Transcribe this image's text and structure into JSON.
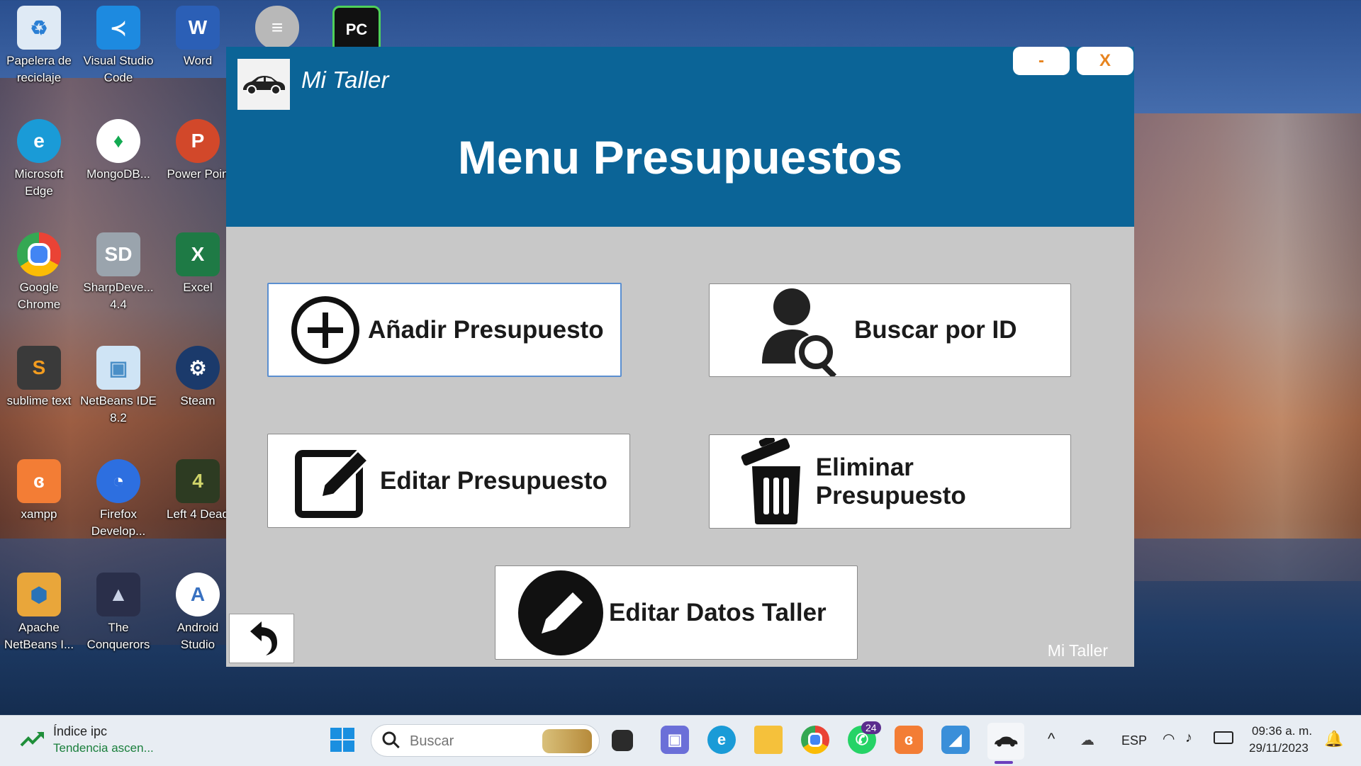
{
  "desktop": {
    "icons": [
      {
        "label": "Papelera de reciclaje",
        "icon": "recycle-bin-icon"
      },
      {
        "label": "Visual Studio Code",
        "icon": "vscode-icon"
      },
      {
        "label": "Word",
        "icon": "word-icon"
      },
      {
        "label": "Microsoft Edge",
        "icon": "edge-icon"
      },
      {
        "label": "MongoDB...",
        "icon": "mongodb-icon"
      },
      {
        "label": "Power Poin",
        "icon": "powerpoint-icon"
      },
      {
        "label": "Google Chrome",
        "icon": "chrome-icon"
      },
      {
        "label": "SharpDeve... 4.4",
        "icon": "sharpdevelop-icon"
      },
      {
        "label": "Excel",
        "icon": "excel-icon"
      },
      {
        "label": "sublime text",
        "icon": "sublime-icon"
      },
      {
        "label": "NetBeans IDE 8.2",
        "icon": "netbeans-icon"
      },
      {
        "label": "Steam",
        "icon": "steam-icon"
      },
      {
        "label": "xampp",
        "icon": "xampp-icon"
      },
      {
        "label": "Firefox Develop...",
        "icon": "firefox-icon"
      },
      {
        "label": "Left 4 Dead",
        "icon": "left4dead-icon"
      },
      {
        "label": "Apache NetBeans I...",
        "icon": "apache-netbeans-icon"
      },
      {
        "label": "The Conquerors",
        "icon": "conquerors-icon"
      },
      {
        "label": "Android Studio",
        "icon": "android-studio-icon"
      }
    ],
    "top_icons": [
      "database-icon",
      "pycharm-icon"
    ]
  },
  "window": {
    "title": "Mi Taller",
    "heading": "Menu Presupuestos",
    "minimize_label": "-",
    "close_label": "X",
    "buttons": {
      "add": "Añadir Presupuesto",
      "search": "Buscar por ID",
      "edit": "Editar Presupuesto",
      "delete": "Eliminar Presupuesto",
      "edit_shop": "Editar Datos Taller"
    },
    "footer": "Mi Taller",
    "colors": {
      "header": "#0b6497",
      "body": "#c8c8c8",
      "accent": "#e7841f"
    }
  },
  "taskbar": {
    "widget_title": "Índice ipc",
    "widget_subtitle": "Tendencia ascen...",
    "search_placeholder": "Buscar",
    "whatsapp_badge": "24",
    "language": "ESP",
    "time": "09:36 a. m.",
    "date": "29/11/2023"
  }
}
